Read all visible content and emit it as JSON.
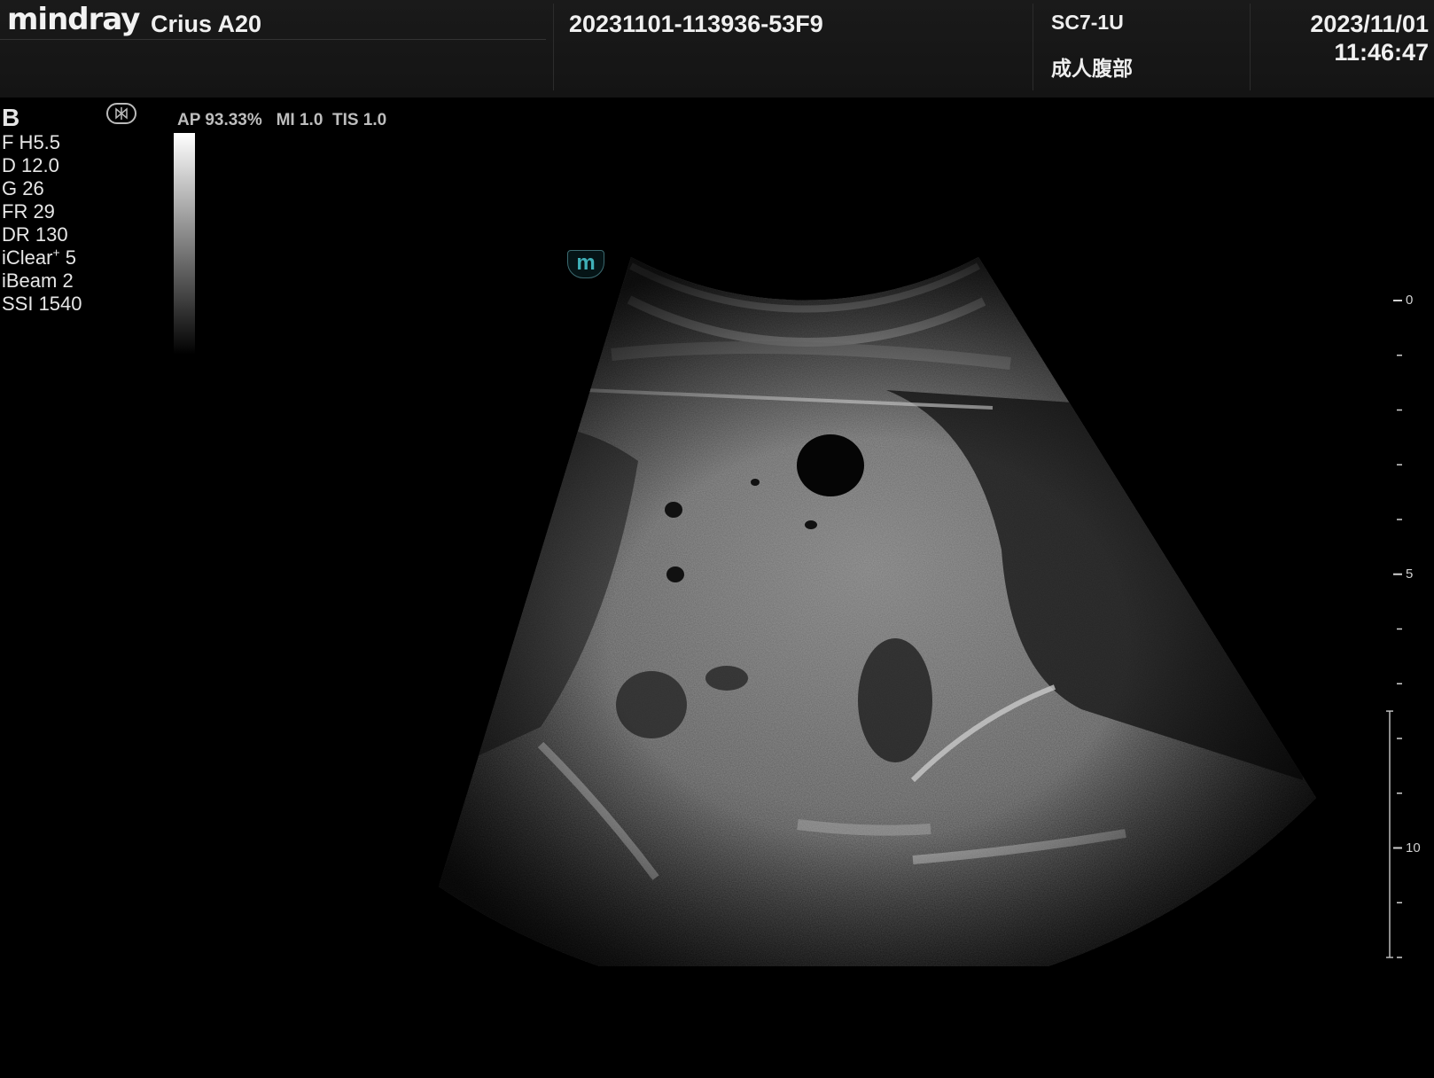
{
  "header": {
    "brand": "mindray",
    "model": "Crius A20",
    "patient_id": "20231101-113936-53F9",
    "probe": "SC7-1U",
    "preset": "成人腹部",
    "date": "2023/11/01",
    "time": "11:46:47"
  },
  "imaging": {
    "mode": "B",
    "params": {
      "frequency": "F H5.5",
      "depth": "D 12.0",
      "gain": "G 26",
      "frame_rate": "FR 29",
      "dynamic_range": "DR 130",
      "iclear_name": "iClear",
      "iclear_sup": "+",
      "iclear_value": "5",
      "ibeam": "iBeam 2",
      "ssi": "SSI 1540"
    },
    "acoustic_output": "AP 93.33%   MI 1.0  TIS 1.0",
    "orientation_marker": "m"
  },
  "depth_scale": {
    "min_cm": 0,
    "max_cm": 12,
    "labels": [
      "0",
      "5",
      "10"
    ],
    "focus_range_cm": [
      7.5,
      12.0
    ]
  },
  "icons": {
    "probe_icon": "probe-orientation-icon",
    "orientation_marker": "orientation-marker-icon"
  }
}
